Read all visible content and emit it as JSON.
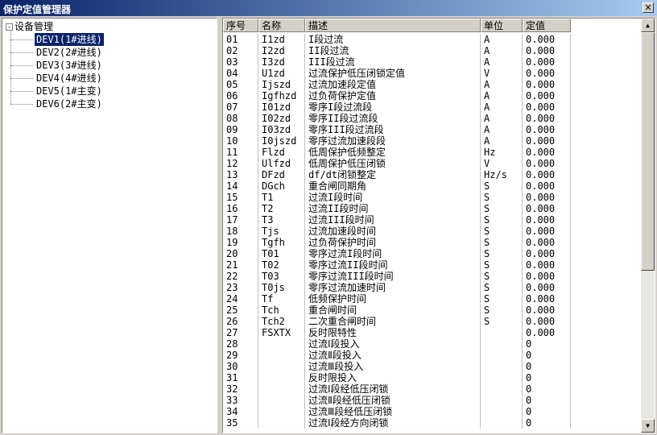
{
  "window": {
    "title": "保护定值管理器",
    "close_icon": "close-icon"
  },
  "tree": {
    "root_label": "设备管理",
    "expander": "-",
    "items": [
      {
        "label": "DEV1(1#进线)",
        "selected": true
      },
      {
        "label": "DEV2(2#进线)",
        "selected": false
      },
      {
        "label": "DEV3(3#进线)",
        "selected": false
      },
      {
        "label": "DEV4(4#进线)",
        "selected": false
      },
      {
        "label": "DEV5(1#主变)",
        "selected": false
      },
      {
        "label": "DEV6(2#主变)",
        "selected": false
      }
    ]
  },
  "table": {
    "columns": [
      "序号",
      "名称",
      "描述",
      "单位",
      "定值"
    ],
    "rows": [
      [
        "01",
        "I1zd",
        "I段过流",
        "A",
        "0.000"
      ],
      [
        "02",
        "I2zd",
        "II段过流",
        "A",
        "0.000"
      ],
      [
        "03",
        "I3zd",
        "III段过流",
        "A",
        "0.000"
      ],
      [
        "04",
        "U1zd",
        "过流保护低压闭锁定值",
        "V",
        "0.000"
      ],
      [
        "05",
        "Ijszd",
        "过流加速段定值",
        "A",
        "0.000"
      ],
      [
        "06",
        "Igfhzd",
        "过负荷保护定值",
        "A",
        "0.000"
      ],
      [
        "07",
        "I01zd",
        "零序I段过流段",
        "A",
        "0.000"
      ],
      [
        "08",
        "I02zd",
        "零序II段过流段",
        "A",
        "0.000"
      ],
      [
        "09",
        "I03zd",
        "零序III段过流段",
        "A",
        "0.000"
      ],
      [
        "10",
        "I0jszd",
        "零序过流加速段段",
        "A",
        "0.000"
      ],
      [
        "11",
        "Flzd",
        "低周保护低频整定",
        "Hz",
        "0.000"
      ],
      [
        "12",
        "Ulfzd",
        "低周保护低压闭锁",
        "V",
        "0.000"
      ],
      [
        "13",
        "DFzd",
        "df/dt闭锁整定",
        "Hz/s",
        "0.000"
      ],
      [
        "14",
        "DGch",
        "重合闸同期角",
        "S",
        "0.000"
      ],
      [
        "15",
        "T1",
        "过流I段时间",
        "S",
        "0.000"
      ],
      [
        "16",
        "T2",
        "过流II段时间",
        "S",
        "0.000"
      ],
      [
        "17",
        "T3",
        "过流III段时间",
        "S",
        "0.000"
      ],
      [
        "18",
        "Tjs",
        "过流加速段时间",
        "S",
        "0.000"
      ],
      [
        "19",
        "Tgfh",
        "过负荷保护时间",
        "S",
        "0.000"
      ],
      [
        "20",
        "T01",
        "零序过流I段时间",
        "S",
        "0.000"
      ],
      [
        "21",
        "T02",
        "零序过流II段时间",
        "S",
        "0.000"
      ],
      [
        "22",
        "T03",
        "零序过流III段时间",
        "S",
        "0.000"
      ],
      [
        "23",
        "T0js",
        "零序过流加速时间",
        "S",
        "0.000"
      ],
      [
        "24",
        "Tf",
        "低频保护时间",
        "S",
        "0.000"
      ],
      [
        "25",
        "Tch",
        "重合闸时间",
        "S",
        "0.000"
      ],
      [
        "26",
        "Tch2",
        "二次重合闸时间",
        "S",
        "0.000"
      ],
      [
        "27",
        "FSXTX",
        "反时限特性",
        "",
        "0.000"
      ],
      [
        "28",
        "",
        "过流Ⅰ段投入",
        "",
        "0"
      ],
      [
        "29",
        "",
        "过流Ⅱ段投入",
        "",
        "0"
      ],
      [
        "30",
        "",
        "过流Ⅲ段投入",
        "",
        "0"
      ],
      [
        "31",
        "",
        "反时限投入",
        "",
        "0"
      ],
      [
        "32",
        "",
        "过流Ⅰ段经低压闭锁",
        "",
        "0"
      ],
      [
        "33",
        "",
        "过流Ⅱ段经低压闭锁",
        "",
        "0"
      ],
      [
        "34",
        "",
        "过流Ⅲ段经低压闭锁",
        "",
        "0"
      ],
      [
        "35",
        "",
        "过流Ⅰ段经方向闭锁",
        "",
        "0"
      ]
    ]
  },
  "scrollbar": {
    "up_icon": "▲",
    "down_icon": "▼"
  }
}
